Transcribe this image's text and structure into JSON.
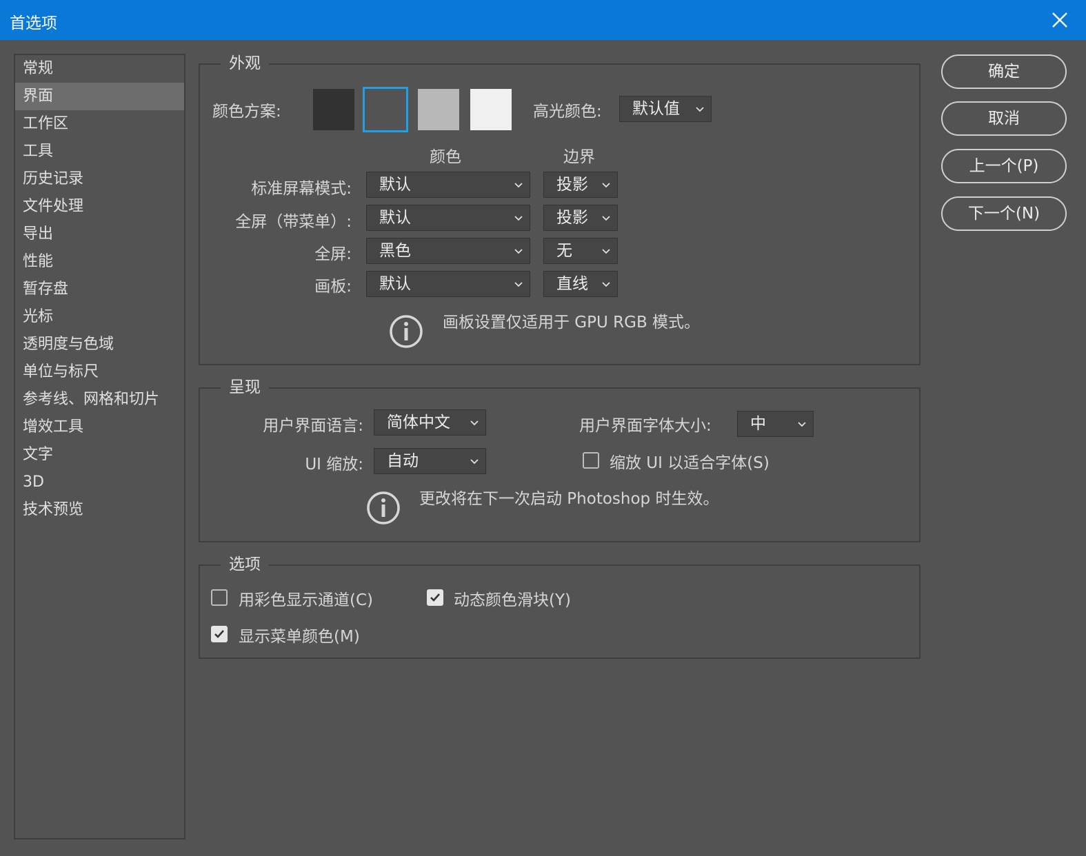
{
  "window": {
    "title": "首选项"
  },
  "sidebar": {
    "items": [
      {
        "label": "常规"
      },
      {
        "label": "界面"
      },
      {
        "label": "工作区"
      },
      {
        "label": "工具"
      },
      {
        "label": "历史记录"
      },
      {
        "label": "文件处理"
      },
      {
        "label": "导出"
      },
      {
        "label": "性能"
      },
      {
        "label": "暂存盘"
      },
      {
        "label": "光标"
      },
      {
        "label": "透明度与色域"
      },
      {
        "label": "单位与标尺"
      },
      {
        "label": "参考线、网格和切片"
      },
      {
        "label": "增效工具"
      },
      {
        "label": "文字"
      },
      {
        "label": "3D"
      },
      {
        "label": "技术预览"
      }
    ],
    "active_index": 1
  },
  "appearance": {
    "group_title": "外观",
    "color_scheme_label": "颜色方案:",
    "swatches": [
      "#323232",
      "#535353",
      "#b8b8b8",
      "#f0f0f0"
    ],
    "selected_swatch": 1,
    "highlight_label": "高光颜色:",
    "highlight_value": "默认值",
    "col_color": "颜色",
    "col_border": "边界",
    "rows": [
      {
        "label": "标准屏幕模式:",
        "color": "默认",
        "border": "投影"
      },
      {
        "label": "全屏（带菜单）:",
        "color": "默认",
        "border": "投影"
      },
      {
        "label": "全屏:",
        "color": "黑色",
        "border": "无"
      },
      {
        "label": "画板:",
        "color": "默认",
        "border": "直线"
      }
    ],
    "info": "画板设置仅适用于 GPU RGB 模式。"
  },
  "presentation": {
    "group_title": "呈现",
    "language_label": "用户界面语言:",
    "language_value": "简体中文",
    "font_size_label": "用户界面字体大小:",
    "font_size_value": "中",
    "ui_scale_label": "UI 缩放:",
    "ui_scale_value": "自动",
    "scale_to_font_label": "缩放 UI 以适合字体(S)",
    "scale_to_font_checked": false,
    "info": "更改将在下一次启动 Photoshop 时生效。"
  },
  "options": {
    "group_title": "选项",
    "show_channels_color_label": "用彩色显示通道(C)",
    "show_channels_color_checked": false,
    "dynamic_sliders_label": "动态颜色滑块(Y)",
    "dynamic_sliders_checked": true,
    "show_menu_colors_label": "显示菜单颜色(M)",
    "show_menu_colors_checked": true
  },
  "buttons": {
    "ok": "确定",
    "cancel": "取消",
    "prev": "上一个(P)",
    "next": "下一个(N)"
  }
}
